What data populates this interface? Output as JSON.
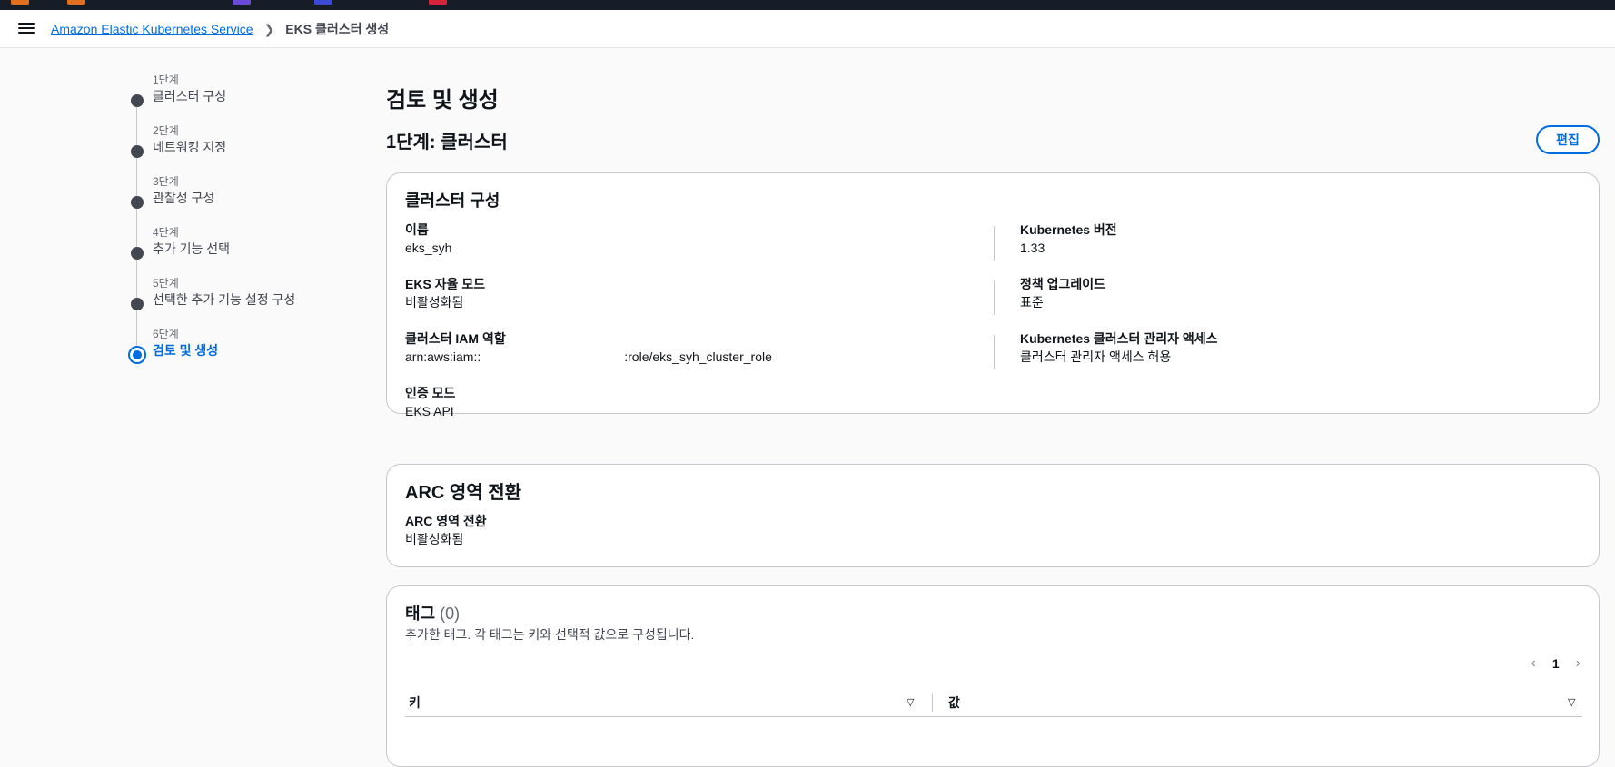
{
  "breadcrumb": {
    "service": "Amazon Elastic Kubernetes Service",
    "current": "EKS 클러스터 생성"
  },
  "steps": [
    {
      "small": "1단계",
      "label": "클러스터 구성"
    },
    {
      "small": "2단계",
      "label": "네트워킹 지정"
    },
    {
      "small": "3단계",
      "label": "관찰성 구성"
    },
    {
      "small": "4단계",
      "label": "추가 기능 선택"
    },
    {
      "small": "5단계",
      "label": "선택한 추가 기능 설정 구성"
    },
    {
      "small": "6단계",
      "label": "검토 및 생성"
    }
  ],
  "page": {
    "title": "검토 및 생성",
    "section_title": "1단계: 클러스터",
    "edit_label": "편집"
  },
  "cluster_config": {
    "title": "클러스터 구성",
    "name_key": "이름",
    "name_val": "eks_syh",
    "auto_mode_key": "EKS 자율 모드",
    "auto_mode_val": "비활성화됨",
    "iam_key": "클러스터 IAM 역할",
    "iam_val_prefix": "arn:aws:iam::",
    "iam_val_suffix": ":role/eks_syh_cluster_role",
    "auth_key": "인증 모드",
    "auth_val": "EKS API",
    "k8s_ver_key": "Kubernetes 버전",
    "k8s_ver_val": "1.33",
    "upgrade_key": "정책 업그레이드",
    "upgrade_val": "표준",
    "admin_key": "Kubernetes 클러스터 관리자 액세스",
    "admin_val": "클러스터 관리자 액세스 허용"
  },
  "arc": {
    "title": "ARC 영역 전환",
    "key": "ARC 영역 전환",
    "val": "비활성화됨"
  },
  "tags": {
    "title": "태그",
    "count": "(0)",
    "description": "추가한 태그. 각 태그는 키와 선택적 값으로 구성됩니다.",
    "page_num": "1",
    "prev_icon": "‹",
    "next_icon": "›",
    "col_key": "키",
    "col_value": "값",
    "sort_glyph": "▽"
  },
  "colors": {
    "accent": "#006ce0",
    "topbar": "#161d26"
  }
}
